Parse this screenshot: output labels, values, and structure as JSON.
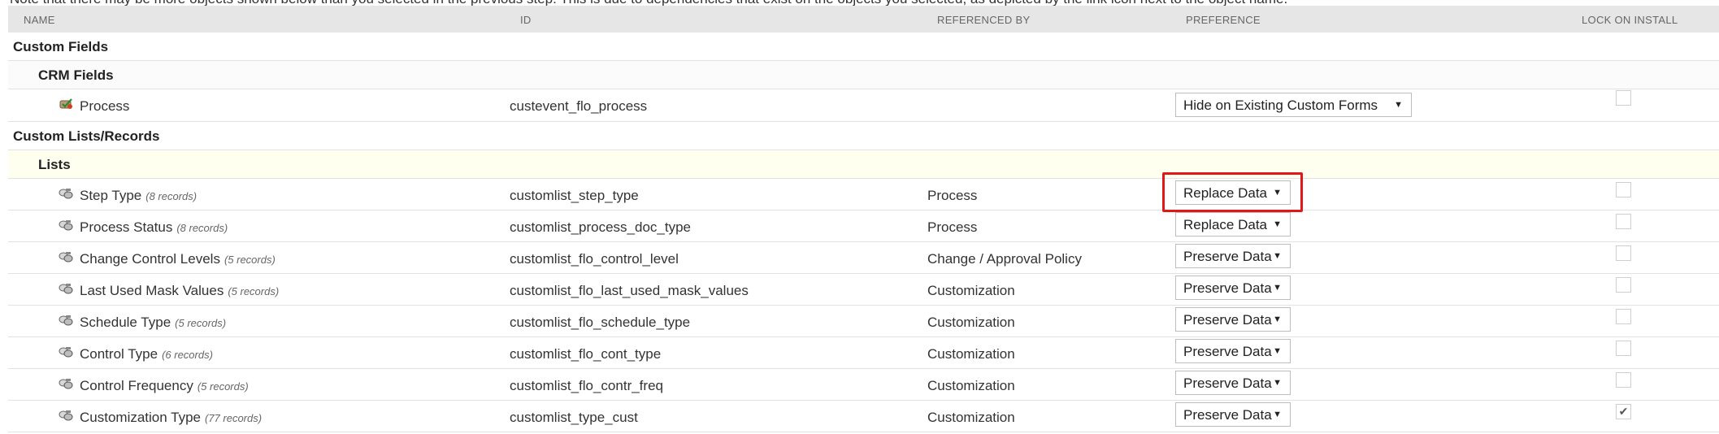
{
  "note": "Note that there may be more objects shown below than you selected in the previous step. This is due to dependencies that exist on the objects you selected, as depicted by the link icon next to the object name.",
  "columns": {
    "name": "NAME",
    "id": "ID",
    "referenced_by": "REFERENCED BY",
    "preference": "PREFERENCE",
    "lock": "LOCK ON INSTALL"
  },
  "groups": {
    "custom_fields": "Custom Fields",
    "crm_fields": "CRM Fields",
    "custom_lists": "Custom Lists/Records",
    "lists": "Lists"
  },
  "process_row": {
    "name": "Process",
    "id": "custevent_flo_process",
    "referenced_by": "",
    "preference": "Hide on Existing Custom Forms",
    "locked": false,
    "icon": "custom-field-icon"
  },
  "list_rows": [
    {
      "name": "Step Type",
      "records": "(8 records)",
      "id": "customlist_step_type",
      "referenced_by": "Process",
      "preference": "Replace Data",
      "locked": false
    },
    {
      "name": "Process Status",
      "records": "(8 records)",
      "id": "customlist_process_doc_type",
      "referenced_by": "Process",
      "preference": "Replace Data",
      "locked": false
    },
    {
      "name": "Change Control Levels",
      "records": "(5 records)",
      "id": "customlist_flo_control_level",
      "referenced_by": "Change / Approval Policy",
      "preference": "Preserve Data",
      "locked": false
    },
    {
      "name": "Last Used Mask Values",
      "records": "(5 records)",
      "id": "customlist_flo_last_used_mask_values",
      "referenced_by": "Customization",
      "preference": "Preserve Data",
      "locked": false
    },
    {
      "name": "Schedule Type",
      "records": "(5 records)",
      "id": "customlist_flo_schedule_type",
      "referenced_by": "Customization",
      "preference": "Preserve Data",
      "locked": false
    },
    {
      "name": "Control Type",
      "records": "(6 records)",
      "id": "customlist_flo_cont_type",
      "referenced_by": "Customization",
      "preference": "Preserve Data",
      "locked": false
    },
    {
      "name": "Control Frequency",
      "records": "(5 records)",
      "id": "customlist_flo_contr_freq",
      "referenced_by": "Customization",
      "preference": "Preserve Data",
      "locked": false
    },
    {
      "name": "Customization Type",
      "records": "(77 records)",
      "id": "customlist_type_cust",
      "referenced_by": "Customization",
      "preference": "Preserve Data",
      "locked": true
    }
  ],
  "highlight_color": "#e01818",
  "dropdown_arrow": "▼",
  "check_glyph": "✔"
}
